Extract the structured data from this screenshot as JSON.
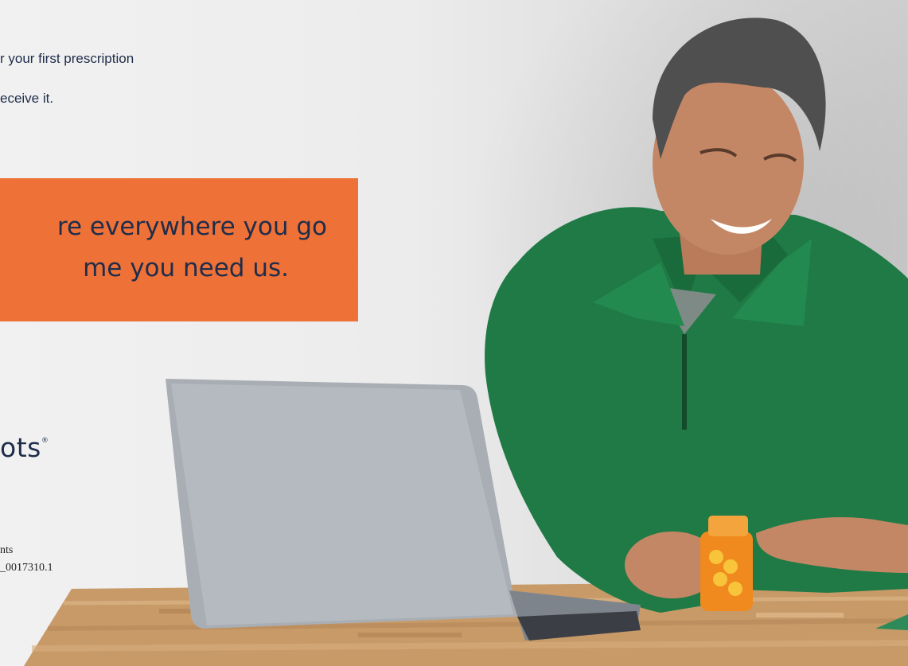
{
  "text": {
    "top_line1": "r your first prescription",
    "top_line2": "eceive it.",
    "banner_line1": "re everywhere you go",
    "banner_line2": "me you need us.",
    "logo": "ots",
    "logo_mark": "®",
    "fine_print1": "nts",
    "fine_print2": "_0017310.1"
  },
  "colors": {
    "banner": "#ee7138",
    "text": "#1f2d4a",
    "sweater": "#1f7a45",
    "pill_bottle": "#f08a1f",
    "table": "#c79a68"
  }
}
